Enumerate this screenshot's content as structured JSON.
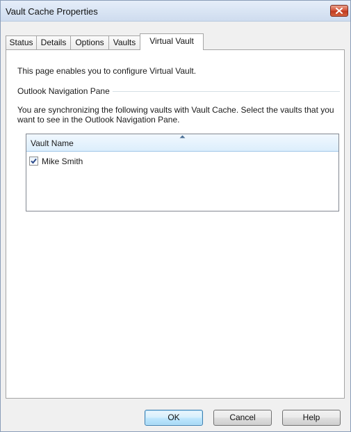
{
  "window": {
    "title": "Vault Cache Properties",
    "close_icon": "close-icon"
  },
  "tabs": [
    {
      "label": "Status",
      "active": false
    },
    {
      "label": "Details",
      "active": false
    },
    {
      "label": "Options",
      "active": false
    },
    {
      "label": "Vaults",
      "active": false
    },
    {
      "label": "Virtual Vault",
      "active": true
    }
  ],
  "panel": {
    "intro": "This page enables you to configure Virtual Vault.",
    "group_label": "Outlook Navigation Pane",
    "description": "You are synchronizing the following vaults with Vault Cache. Select the vaults that you want to see in the Outlook Navigation Pane.",
    "list": {
      "column_header": "Vault Name",
      "sort_icon": "sort-ascending-icon",
      "rows": [
        {
          "label": "Mike Smith",
          "checked": true
        }
      ]
    }
  },
  "buttons": {
    "ok": "OK",
    "cancel": "Cancel",
    "help": "Help"
  },
  "colors": {
    "title_bar": "#d7e3f3",
    "close_button": "#c03a20",
    "list_header": "#dceefc",
    "default_button_border": "#3c7fb1"
  }
}
